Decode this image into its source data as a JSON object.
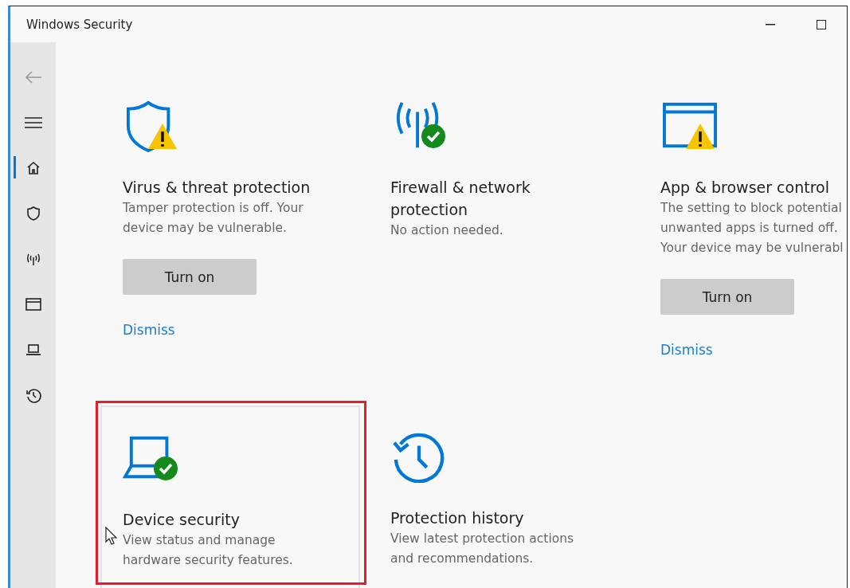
{
  "window": {
    "title": "Windows Security"
  },
  "sidebar": {
    "items": [
      {
        "selected": true
      },
      {
        "selected": false
      },
      {
        "selected": false
      },
      {
        "selected": false
      },
      {
        "selected": false
      },
      {
        "selected": false
      }
    ]
  },
  "cards": [
    {
      "kind": "warning",
      "title": "Virus & threat protection",
      "description": "Tamper protection is off. Your\ndevice may be vulnerable.",
      "button": "Turn on",
      "link": "Dismiss",
      "highlighted": false
    },
    {
      "kind": "ok",
      "title": "Firewall & network\nprotection",
      "description": "No action needed.",
      "highlighted": false
    },
    {
      "kind": "warning",
      "title": "App & browser control",
      "description": "The setting to block potential\nunwanted apps is turned off.\nYour device may be vulnerabl",
      "button": "Turn on",
      "link": "Dismiss",
      "highlighted": false
    },
    {
      "kind": "ok",
      "title": "Device security",
      "description": "View status and manage\nhardware security features.",
      "highlighted": true
    },
    {
      "kind": "plain",
      "title": "Protection history",
      "description": "View latest protection actions\nand recommendations.",
      "highlighted": false
    }
  ]
}
